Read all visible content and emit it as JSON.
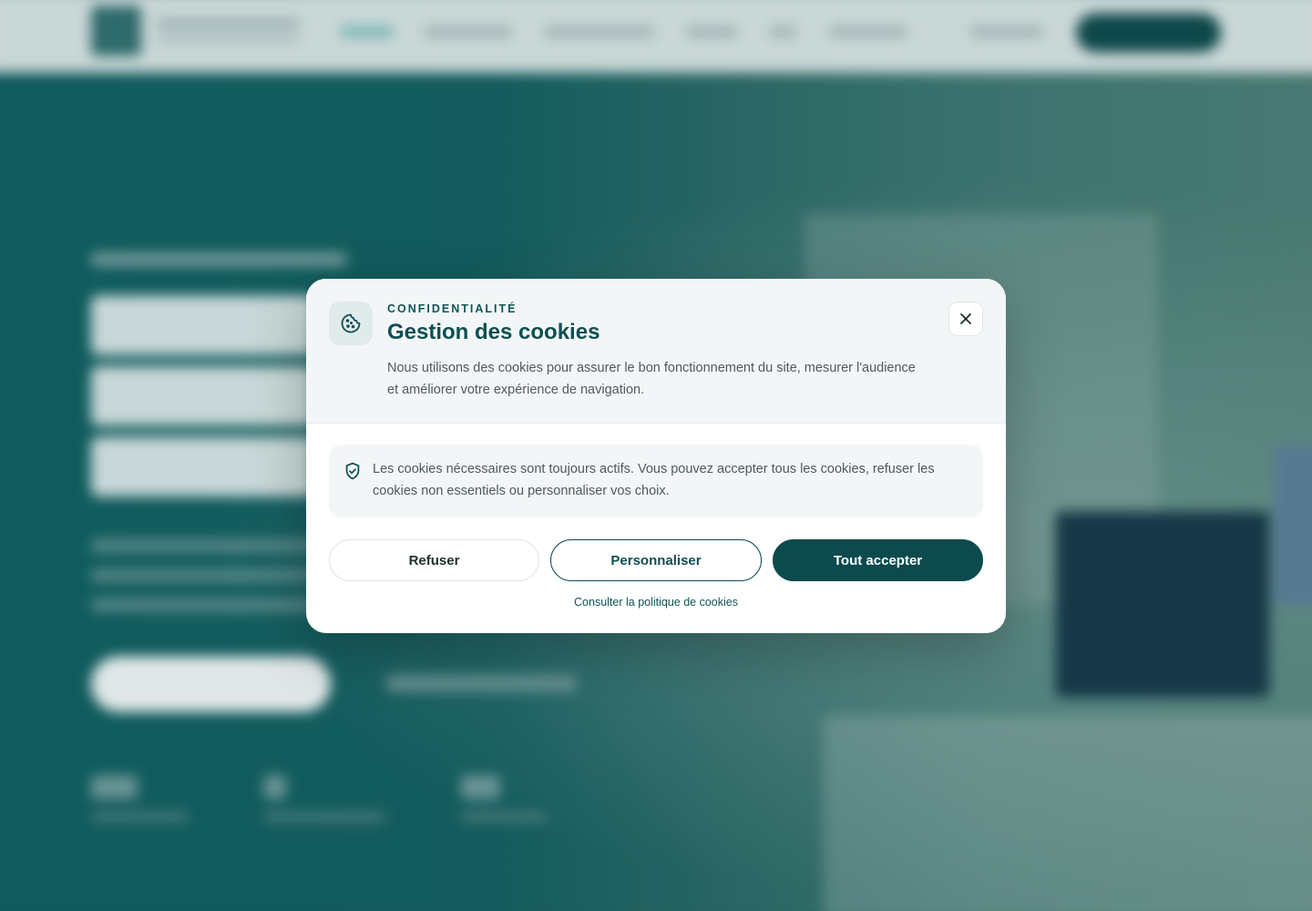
{
  "modal": {
    "eyebrow": "CONFIDENTIALITÉ",
    "title": "Gestion des cookies",
    "description": "Nous utilisons des cookies pour assurer le bon fonctionnement du site, mesurer l'audience et améliorer votre expérience de navigation.",
    "notice": "Les cookies nécessaires sont toujours actifs. Vous pouvez accepter tous les cookies, refuser les cookies non essentiels ou personnaliser vos choix.",
    "buttons": {
      "refuse": "Refuser",
      "customize": "Personnaliser",
      "accept_all": "Tout accepter"
    },
    "policy_link": "Consulter la politique de cookies",
    "icons": {
      "header": "cookie-icon",
      "notice": "shield-check-icon",
      "close": "close-icon"
    }
  },
  "colors": {
    "primary": "#0c4a4d",
    "header_bg": "#f3f6f7",
    "text_muted": "#4e5a5c"
  }
}
